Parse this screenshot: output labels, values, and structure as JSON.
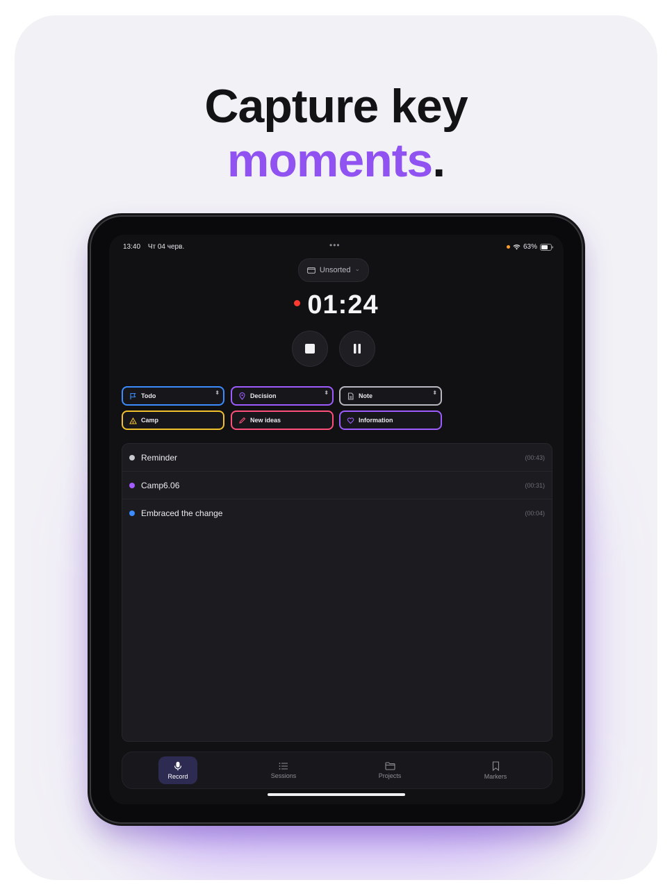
{
  "headline": {
    "line1": "Capture key",
    "accent": "moments",
    "period": "."
  },
  "status_bar": {
    "time": "13:40",
    "date": "Чт 04 черв.",
    "battery": "63%"
  },
  "project_pill": {
    "label": "Unsorted",
    "chevron": "⌄",
    "icon": "folder-icon"
  },
  "timer": {
    "value": "01:24",
    "recording": true
  },
  "controls": {
    "stop": "stop-icon",
    "pause": "pause-icon"
  },
  "markers": [
    {
      "label": "Todo",
      "color": "#3b8cff",
      "icon": "flag-icon",
      "pinned": true
    },
    {
      "label": "Decision",
      "color": "#9d5cff",
      "icon": "pin-icon",
      "pinned": true
    },
    {
      "label": "Note",
      "color": "#b8b8c0",
      "icon": "note-icon",
      "pinned": true
    },
    {
      "label": "Camp",
      "color": "#f2c12e",
      "icon": "camp-icon",
      "pinned": false
    },
    {
      "label": "New ideas",
      "color": "#ff4f7b",
      "icon": "pencil-icon",
      "pinned": false
    },
    {
      "label": "Information",
      "color": "#9d5cff",
      "icon": "heart-icon",
      "pinned": false
    }
  ],
  "entries": [
    {
      "label": "Reminder",
      "time": "(00:43)",
      "color": "#c8c8cf"
    },
    {
      "label": "Camp6.06",
      "time": "(00:31)",
      "color": "#a35cff"
    },
    {
      "label": "Embraced the change",
      "time": "(00:04)",
      "color": "#3b8cff"
    }
  ],
  "tabs": [
    {
      "label": "Record",
      "icon": "mic-icon",
      "active": true
    },
    {
      "label": "Sessions",
      "icon": "list-icon",
      "active": false
    },
    {
      "label": "Projects",
      "icon": "folder-icon",
      "active": false
    },
    {
      "label": "Markers",
      "icon": "bookmark-icon",
      "active": false
    }
  ]
}
